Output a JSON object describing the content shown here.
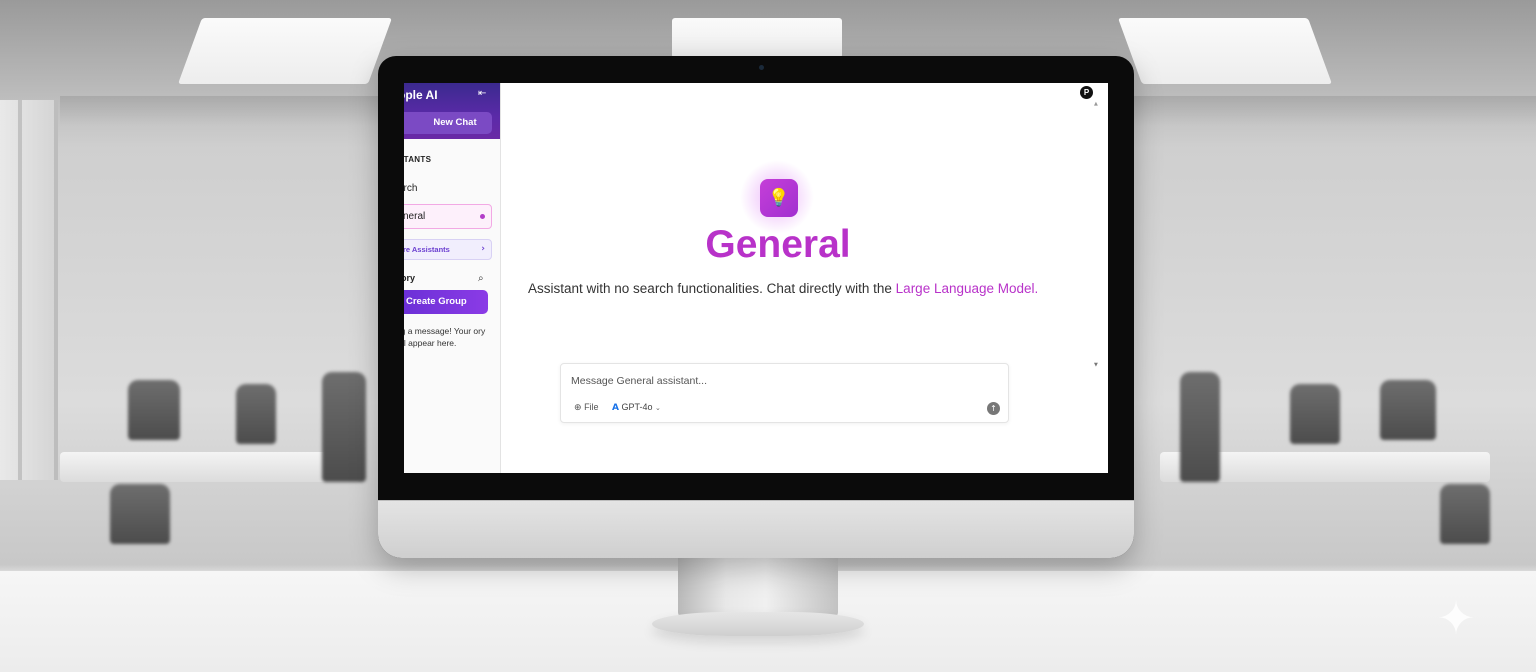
{
  "sidebar": {
    "brand": "ople AI",
    "collapse_icon": "⇤",
    "new_chat_label": "New Chat",
    "assistants_title": "STANTS",
    "items": [
      {
        "label": "arch"
      },
      {
        "label": "neral"
      }
    ],
    "explore_label": "re Assistants",
    "explore_chevron": "›",
    "history_title": "tory",
    "history_search_icon": "⌕",
    "create_group_label": "Create Group",
    "empty_note": "ing a message! Your ory will appear here."
  },
  "main": {
    "avatar_letter": "P",
    "bulb_icon": "💡",
    "title": "General",
    "subtitle_prefix": "Assistant with no search functionalities. Chat directly with the ",
    "subtitle_highlight": "Large Language Model.",
    "composer": {
      "placeholder": "Message General assistant...",
      "file_icon": "⊕",
      "file_label": "File",
      "model_icon": "A",
      "model_label": "GPT-4o",
      "model_chevron": "⌄",
      "send_icon": "↑"
    },
    "scroll_up": "▲",
    "scroll_down": "▼"
  },
  "decor": {
    "sparkle": "✦"
  }
}
